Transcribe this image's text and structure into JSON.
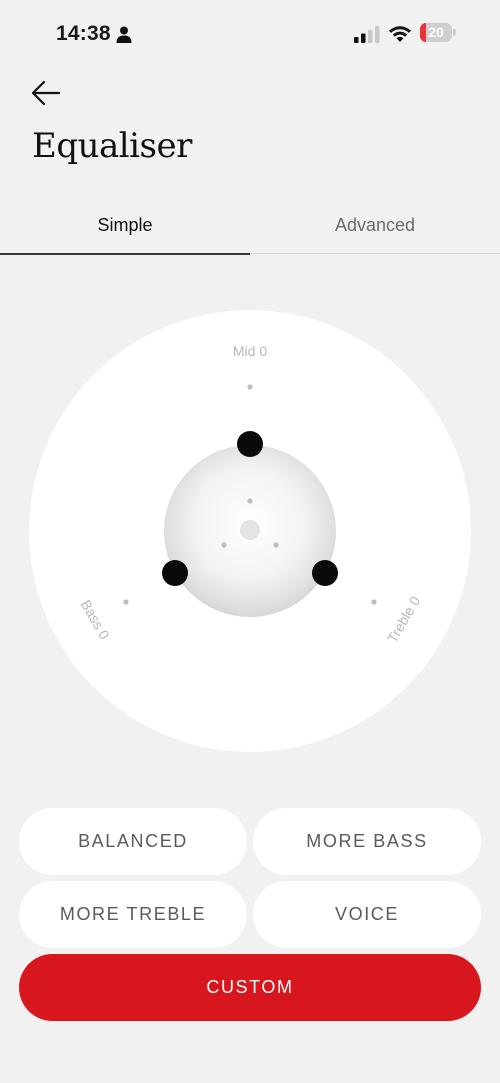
{
  "status_bar": {
    "time": "14:38",
    "person_icon": "person-icon",
    "signal_icon": "cellular-signal-icon",
    "wifi_icon": "wifi-icon",
    "battery_level": "20",
    "battery_fraction": 0.2,
    "battery_color": "#e8323c"
  },
  "header": {
    "back_icon": "arrow-left-icon",
    "title": "Equaliser"
  },
  "tabs": [
    {
      "label": "Simple",
      "selected": true
    },
    {
      "label": "Advanced",
      "selected": false
    }
  ],
  "equaliser": {
    "mid_label": "Mid 0",
    "bass_label": "Bass 0",
    "treble_label": "Treble 0",
    "mid_value": 0,
    "bass_value": 0,
    "treble_value": 0
  },
  "presets": {
    "balanced": "BALANCED",
    "more_bass": "MORE BASS",
    "more_treble": "MORE TREBLE",
    "voice": "VOICE",
    "custom": "CUSTOM",
    "selected": "custom"
  },
  "colors": {
    "accent": "#d7161e",
    "background": "#f1f1f1",
    "button_bg": "#ffffff"
  }
}
